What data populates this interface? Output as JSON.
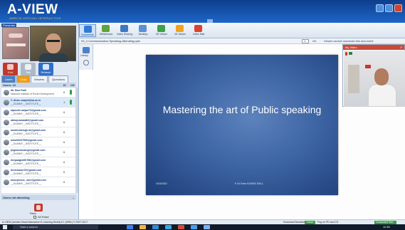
{
  "app": {
    "logo": "A-VIEW",
    "logo_sub": "AMRITA VIRTUAL INTERACTIVE"
  },
  "left": {
    "presenter_label": "Presenter",
    "controls": [
      "Exit",
      "Talk",
      "Refresh"
    ],
    "tabs": [
      "Users",
      "Chat",
      "Viewers",
      "Questions"
    ],
    "users_header": "Users: 13",
    "col_ic": "IC",
    "col_cs": "CS",
    "users": [
      {
        "name": "Mr. Ravi Patil",
        "org": "National Institute of Rural Development",
        "count": "6"
      },
      {
        "name": "V. divas cwaphi@au.ac.in",
        "org": "__DUMMY__INSTITUTE__",
        "count": "1"
      },
      {
        "name": "alpuudh.ranjan73@gmail.com",
        "org": "__DUMMY__INSTITUTE__",
        "count": "6"
      },
      {
        "name": "abhayrastala83@gmail.com",
        "org": "__DUMMY__INSTITUTE__",
        "count": "6"
      },
      {
        "name": "anubhutisingh.iit@gmail.com",
        "org": "__DUMMY__INSTITUTE__",
        "count": "6"
      },
      {
        "name": "ashu05207590@gmail.com",
        "org": "__DUMMY__INSTITUTE__",
        "count": "6"
      },
      {
        "name": "jingidonbewingh@gmail.com",
        "org": "__DUMMY__INSTITUTE__",
        "count": "6"
      },
      {
        "name": "deepaagbd00786@gmail.com",
        "org": "__DUMMY__INSTITUTE__",
        "count": "6"
      },
      {
        "name": "devicharan79@gmail.com",
        "org": "__DUMMY__INSTITUTE__",
        "count": "6"
      },
      {
        "name": "anonymous_user@gmail.com",
        "org": "__DUMMY__INSTITUTE__",
        "count": "6"
      }
    ],
    "not_attending": "Users not attending",
    "raise_label": "Raise",
    "all_raise": "All Raise"
  },
  "toolbar": {
    "items": [
      "Documents",
      "Whiteboard",
      "Video Sharing",
      "Desktop",
      "3D Viewer",
      "2D Viewer",
      "Video Mail"
    ]
  },
  "doc": {
    "path": "03_2-Communication-Speaking-Attending.pptx",
    "page": "1",
    "page_total": "/41",
    "download_note": "Viewer cannot download this document",
    "library": "Library"
  },
  "slide": {
    "title": "Mastering the art of Public speaking",
    "date": "4/16/2020",
    "author": "K Sri Sree KASHIS SKILL"
  },
  "myvideo": {
    "title": "My Video",
    "arrow": "↗"
  },
  "status": {
    "left": "A-VIEW (Amrita Virtual Interactive E-Learning World) 5.1 (9991) © 2007-2017",
    "bandwidth_label": "Download Bandwidth",
    "bandwidth_value": "Good",
    "ppd": "Fog on PD and CS",
    "connection": "Connected  Tele..."
  },
  "taskbar": {
    "search": "Start a search",
    "time": "11:55"
  },
  "colors": {
    "header": "#1d66c8",
    "accent": "#2e6fc4",
    "good": "#3aa346"
  }
}
